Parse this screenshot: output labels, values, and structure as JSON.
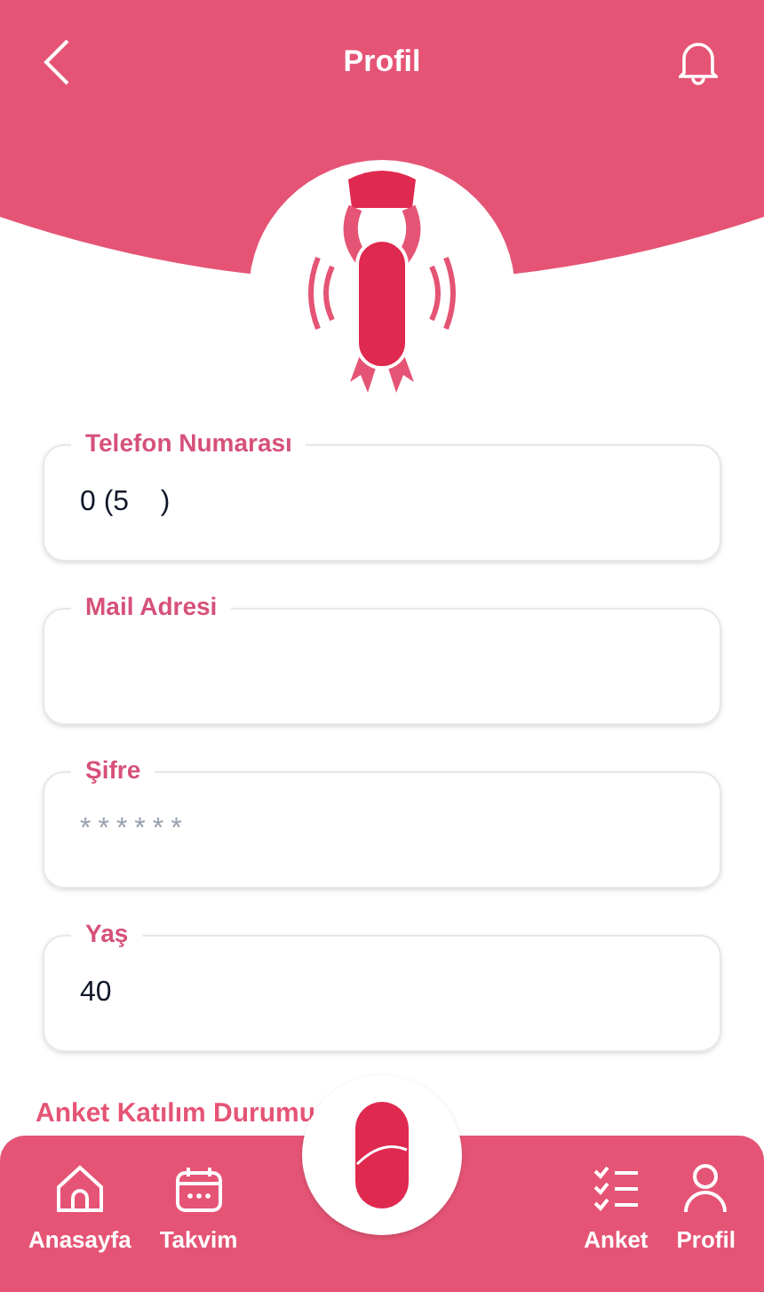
{
  "header": {
    "title": "Profil"
  },
  "fields": [
    {
      "label": "Telefon Numarası",
      "value": "0 (5    )",
      "kind": "text"
    },
    {
      "label": "Mail Adresi",
      "kind": "text"
    },
    {
      "label": "Şifre",
      "value": "******",
      "kind": "password"
    },
    {
      "label": "Yaş",
      "value": "40",
      "kind": "text"
    }
  ],
  "section_title": "Anket Katılım Durumu",
  "nav": [
    {
      "label": "Anasayfa",
      "kind": "home"
    },
    {
      "label": "Takvim",
      "kind": "calendar"
    },
    {
      "label": "Anket",
      "kind": "survey"
    },
    {
      "label": "Profil",
      "kind": "profile"
    }
  ]
}
